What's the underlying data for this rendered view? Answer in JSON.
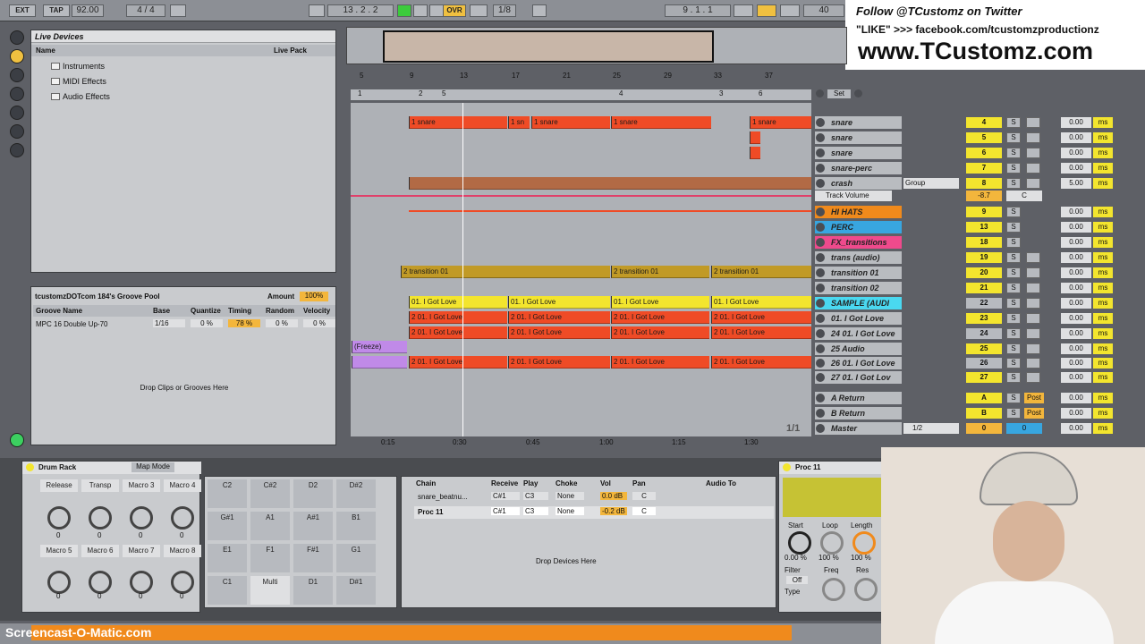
{
  "toolbar": {
    "ext": "EXT",
    "tap": "TAP",
    "tempo": "92.00",
    "sig": "4 / 4",
    "position": "13 . 2 . 2",
    "ovr": "OVR",
    "quant": "1/8",
    "loop_start": "9 . 1 . 1",
    "loop_len": "40"
  },
  "overlay": {
    "twitter": "Follow @TCustomz on Twitter",
    "facebook": "\"LIKE\" >>> facebook.com/tcustomzproductionz",
    "site": "www.TCustomz.com",
    "screencast": "Screencast-O-Matic.com"
  },
  "browser": {
    "title": "Live Devices",
    "col_name": "Name",
    "col_pack": "Live Pack",
    "items": [
      "Instruments",
      "MIDI Effects",
      "Audio Effects"
    ]
  },
  "groove": {
    "title": "tcustomzDOTcom 184's Groove Pool",
    "amount_label": "Amount",
    "amount": "100%",
    "headers": [
      "Groove Name",
      "Base",
      "Quantize",
      "Timing",
      "Random",
      "Velocity"
    ],
    "row": [
      "MPC 16 Double Up-70",
      "1/16",
      "0 %",
      "78 %",
      "0 %",
      "0 %"
    ],
    "drop": "Drop Clips or Grooves Here"
  },
  "ruler": {
    "bars": [
      "5",
      "9",
      "13",
      "17",
      "21",
      "25",
      "29",
      "33",
      "37"
    ],
    "markers": [
      "1",
      "2",
      "5",
      "4",
      "3",
      "6"
    ],
    "times": [
      "0:15",
      "0:30",
      "0:45",
      "1:00",
      "1:15",
      "1:30"
    ],
    "set": "Set",
    "page": "1/1"
  },
  "clips": {
    "snare": "1 snare",
    "sn": "1 sn",
    "trans": "2 transition 01",
    "love": "01. I Got Love",
    "love2": "2 01. I Got Love",
    "freeze": "(Freeze)"
  },
  "tracks": [
    {
      "name": "snare",
      "num": "4",
      "vol": "0.00"
    },
    {
      "name": "snare",
      "num": "5",
      "vol": "0.00"
    },
    {
      "name": "snare",
      "num": "6",
      "vol": "0.00"
    },
    {
      "name": "snare-perc",
      "num": "7",
      "vol": "0.00"
    },
    {
      "name": "crash",
      "num": "8",
      "vol": "5.00"
    },
    {
      "name": "HI HATS",
      "num": "9",
      "vol": "0.00"
    },
    {
      "name": "PERC",
      "num": "13",
      "vol": "0.00"
    },
    {
      "name": "FX_transitions",
      "num": "18",
      "vol": "0.00"
    },
    {
      "name": "trans (audio)",
      "num": "19",
      "vol": "0.00"
    },
    {
      "name": "transition 01",
      "num": "20",
      "vol": "0.00"
    },
    {
      "name": "transition 02",
      "num": "21",
      "vol": "0.00"
    },
    {
      "name": "SAMPLE (AUDI",
      "num": "22",
      "vol": "0.00"
    },
    {
      "name": "01. I Got Love",
      "num": "23",
      "vol": "0.00"
    },
    {
      "name": "24 01. I Got Love",
      "num": "24",
      "vol": "0.00"
    },
    {
      "name": "25 Audio",
      "num": "25",
      "vol": "0.00"
    },
    {
      "name": "26 01. I Got Love",
      "num": "26",
      "vol": "0.00"
    },
    {
      "name": "27 01. I Got Lov",
      "num": "27",
      "vol": "0.00"
    }
  ],
  "returns": [
    {
      "name": "A Return",
      "label": "A",
      "vol": "0.00"
    },
    {
      "name": "B Return",
      "label": "B",
      "vol": "0.00"
    },
    {
      "name": "Master",
      "label": "0",
      "vol": "0.00"
    }
  ],
  "crash_extra": {
    "group": "Group",
    "automation": "Track Volume",
    "value": "-8.7",
    "pan": "C",
    "sends": "1/2",
    "post": "Post",
    "ms": "ms",
    "s": "S"
  },
  "drumrack": {
    "title": "Drum Rack",
    "mapmode": "Map Mode",
    "macros": [
      "Release",
      "Transp",
      "Macro 3",
      "Macro 4",
      "Macro 5",
      "Macro 6",
      "Macro 7",
      "Macro 8"
    ],
    "knobvals": [
      "0",
      "0",
      "0",
      "0",
      "0",
      "0",
      "0",
      "0"
    ],
    "pads": [
      "C2",
      "C#2",
      "D2",
      "D#2",
      "G#1",
      "A1",
      "A#1",
      "B1",
      "E1",
      "F1",
      "F#1",
      "G1",
      "C1",
      "Multi",
      "D1",
      "D#1"
    ],
    "chain_headers": [
      "Chain",
      "Receive",
      "Play",
      "Choke",
      "Vol",
      "Pan",
      "Audio To"
    ],
    "chains": [
      {
        "name": "snare_beatnu...",
        "recv": "C#1",
        "play": "C3",
        "choke": "None",
        "vol": "0.0 dB",
        "pan": "C"
      },
      {
        "name": "Proc 11",
        "recv": "C#1",
        "play": "C3",
        "choke": "None",
        "vol": "-0.2 dB",
        "pan": "C"
      }
    ],
    "drop": "Drop Devices Here"
  },
  "simpler": {
    "title": "Proc 11",
    "start": "Start",
    "loop": "Loop",
    "length": "Length",
    "start_v": "0.00 %",
    "loop_v": "100 %",
    "length_v": "100 %",
    "filter": "Filter",
    "off": "Off",
    "freq": "Freq",
    "res": "Res",
    "type": "Type"
  }
}
